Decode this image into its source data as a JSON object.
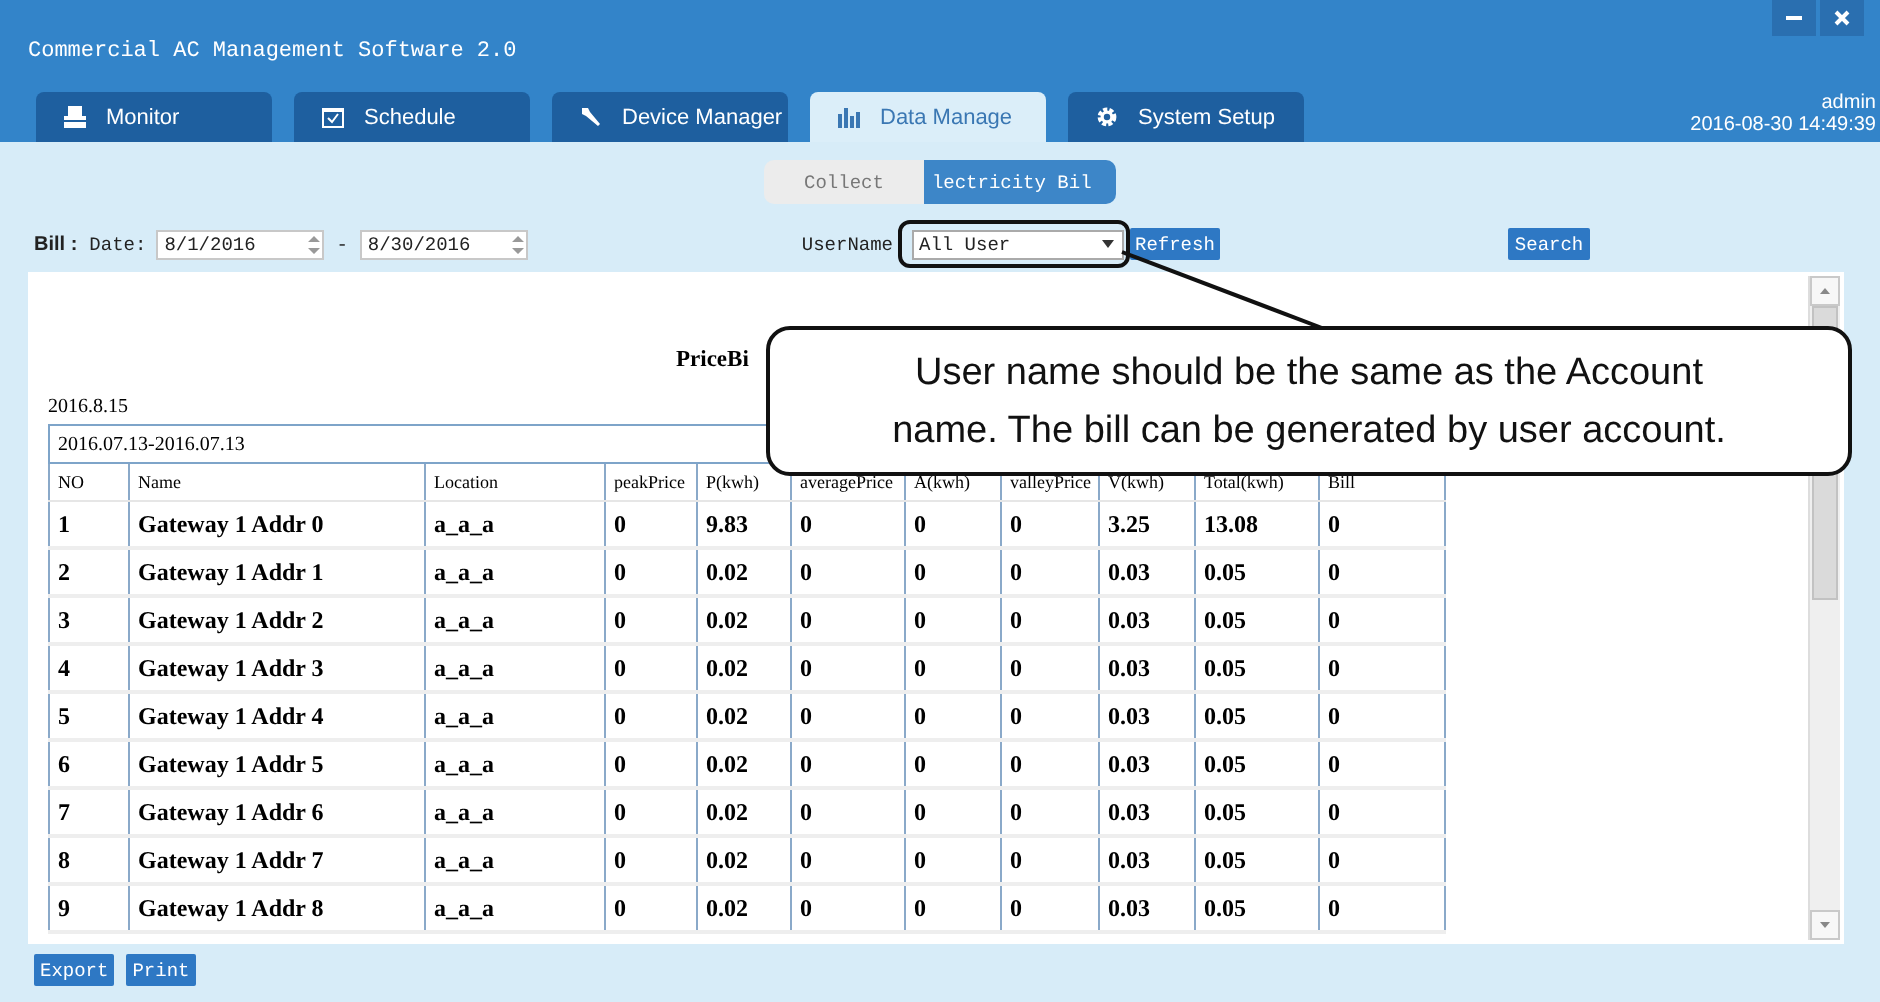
{
  "window": {
    "title": "Commercial AC Management Software 2.0"
  },
  "session": {
    "user": "admin",
    "datetime": "2016-08-30 14:49:39"
  },
  "tabs": [
    {
      "label": "Monitor",
      "selected": false
    },
    {
      "label": "Schedule",
      "selected": false
    },
    {
      "label": "Device Manager",
      "selected": false
    },
    {
      "label": "Data Manage",
      "selected": true
    },
    {
      "label": "System Setup",
      "selected": false
    }
  ],
  "subtabs": [
    {
      "label": "Collect",
      "selected": false
    },
    {
      "label": "lectricity Bil",
      "selected": true
    }
  ],
  "toolbar": {
    "bill_label": "Bill :",
    "date_label": "Date:",
    "date_from": "8/1/2016",
    "range_separator": "-",
    "date_to": "8/30/2016",
    "username_label": "UserName",
    "username": "All User",
    "refresh": "Refresh",
    "search": "Search"
  },
  "report": {
    "title": "PriceBi",
    "date": "2016.8.15",
    "period": "2016.07.13-2016.07.13",
    "columns": [
      "NO",
      "Name",
      "Location",
      "peakPrice",
      "P(kwh)",
      "averagePrice",
      "A(kwh)",
      "valleyPrice",
      "V(kwh)",
      "Total(kwh)",
      "Bill"
    ],
    "rows": [
      [
        "1",
        "Gateway 1 Addr 0",
        "a_a_a",
        "0",
        "9.83",
        "0",
        "0",
        "0",
        "3.25",
        "13.08",
        "0"
      ],
      [
        "2",
        "Gateway 1 Addr 1",
        "a_a_a",
        "0",
        "0.02",
        "0",
        "0",
        "0",
        "0.03",
        "0.05",
        "0"
      ],
      [
        "3",
        "Gateway 1 Addr 2",
        "a_a_a",
        "0",
        "0.02",
        "0",
        "0",
        "0",
        "0.03",
        "0.05",
        "0"
      ],
      [
        "4",
        "Gateway 1 Addr 3",
        "a_a_a",
        "0",
        "0.02",
        "0",
        "0",
        "0",
        "0.03",
        "0.05",
        "0"
      ],
      [
        "5",
        "Gateway 1 Addr 4",
        "a_a_a",
        "0",
        "0.02",
        "0",
        "0",
        "0",
        "0.03",
        "0.05",
        "0"
      ],
      [
        "6",
        "Gateway 1 Addr 5",
        "a_a_a",
        "0",
        "0.02",
        "0",
        "0",
        "0",
        "0.03",
        "0.05",
        "0"
      ],
      [
        "7",
        "Gateway 1 Addr 6",
        "a_a_a",
        "0",
        "0.02",
        "0",
        "0",
        "0",
        "0.03",
        "0.05",
        "0"
      ],
      [
        "8",
        "Gateway 1 Addr 7",
        "a_a_a",
        "0",
        "0.02",
        "0",
        "0",
        "0",
        "0.03",
        "0.05",
        "0"
      ],
      [
        "9",
        "Gateway 1 Addr 8",
        "a_a_a",
        "0",
        "0.02",
        "0",
        "0",
        "0",
        "0.03",
        "0.05",
        "0"
      ]
    ]
  },
  "footer_buttons": [
    "Export",
    "Print"
  ],
  "callout": {
    "lines": [
      "User name should be the same as the Account",
      "name. The bill can be generated by user account."
    ]
  }
}
